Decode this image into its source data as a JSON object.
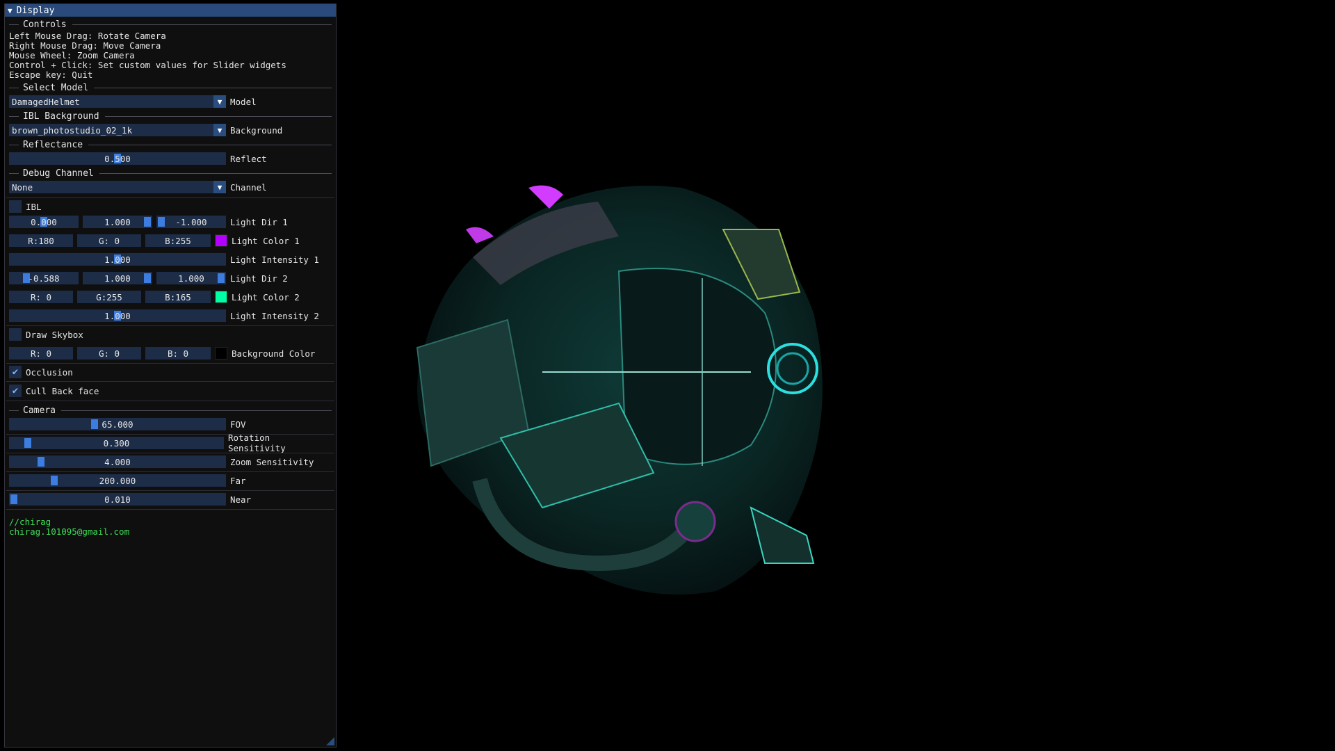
{
  "window": {
    "title": "Display"
  },
  "controls": {
    "header": "Controls",
    "lines": [
      "Left Mouse Drag: Rotate Camera",
      "Right Mouse Drag: Move Camera",
      "Mouse Wheel: Zoom Camera",
      "Control + Click: Set custom values for Slider widgets",
      "Escape key: Quit"
    ]
  },
  "select_model": {
    "header": "Select Model",
    "value": "DamagedHelmet",
    "label": "Model"
  },
  "ibl_background": {
    "header": "IBL Background",
    "value": "brown_photostudio_02_1k",
    "label": "Background"
  },
  "reflectance": {
    "header": "Reflectance",
    "value": "0.500",
    "level": 0.5,
    "label": "Reflect"
  },
  "debug_channel": {
    "header": "Debug Channel",
    "value": "None",
    "label": "Channel"
  },
  "ibl": {
    "label": "IBL",
    "checked": false
  },
  "light1": {
    "dir": [
      "0.000",
      "1.000",
      "-1.000"
    ],
    "dir_label": "Light Dir 1",
    "color": [
      "R:180",
      "G:  0",
      "B:255"
    ],
    "color_label": "Light Color 1",
    "swatch": "#b400ff",
    "intensity": "1.000",
    "intensity_label": "Light Intensity 1"
  },
  "light2": {
    "dir": [
      "-0.588",
      "1.000",
      "1.000"
    ],
    "dir_label": "Light Dir 2",
    "color": [
      "R:  0",
      "G:255",
      "B:165"
    ],
    "color_label": "Light Color 2",
    "swatch": "#00ffa5",
    "intensity": "1.000",
    "intensity_label": "Light Intensity 2"
  },
  "skybox": {
    "label": "Draw Skybox",
    "checked": false,
    "color": [
      "R:  0",
      "G:  0",
      "B:  0"
    ],
    "color_label": "Background Color",
    "swatch": "#000000"
  },
  "occlusion": {
    "label": "Occlusion",
    "checked": true
  },
  "cull": {
    "label": "Cull Back face",
    "checked": true
  },
  "camera": {
    "header": "Camera",
    "fov": {
      "value": "65.000",
      "label": "FOV"
    },
    "rotation": {
      "value": "0.300",
      "label": "Rotation Sensitivity"
    },
    "zoom": {
      "value": "4.000",
      "label": "Zoom Sensitivity"
    },
    "far": {
      "value": "200.000",
      "label": "Far"
    },
    "near": {
      "value": "0.010",
      "label": "Near"
    }
  },
  "footer": {
    "line1": "//chirag",
    "line2": "chirag.101095@gmail.com"
  },
  "colors": {
    "accent": "#3d7de0",
    "frame": "#1d2d47",
    "title": "#294a7a",
    "footer_text": "#3ddf55"
  }
}
